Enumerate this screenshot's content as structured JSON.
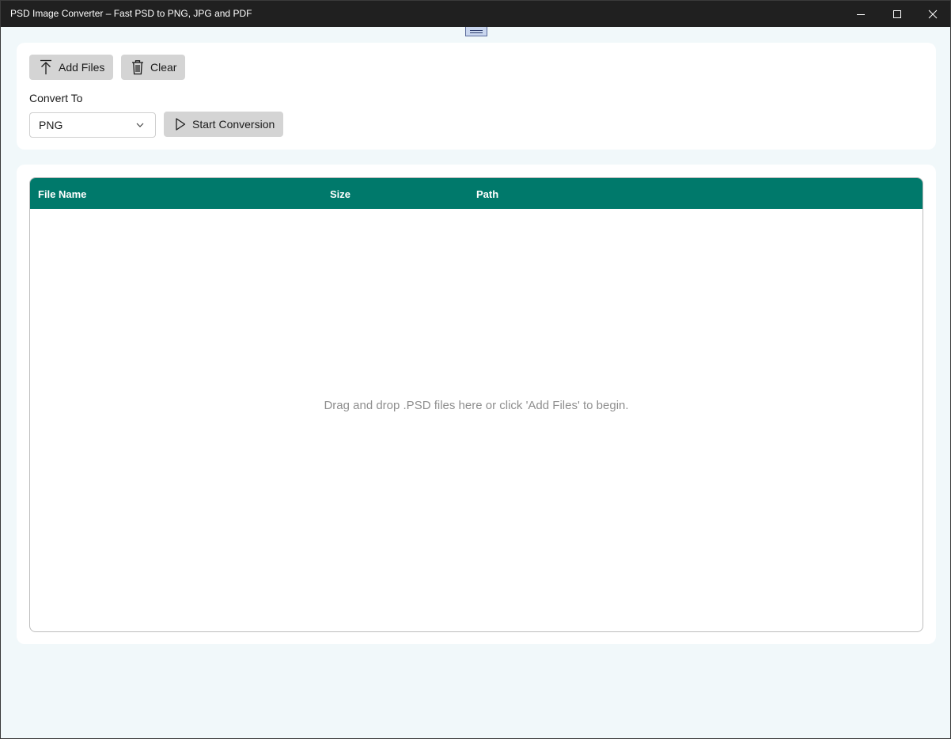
{
  "window": {
    "title": "PSD Image Converter – Fast PSD to PNG, JPG and PDF",
    "minimize_icon": "minimize-icon",
    "maximize_icon": "maximize-icon",
    "close_icon": "close-icon"
  },
  "toolbar": {
    "add_files_label": "Add Files",
    "add_files_icon": "upload-arrow-icon",
    "clear_label": "Clear",
    "clear_icon": "trash-icon",
    "convert_to_label": "Convert To",
    "format_selected": "PNG",
    "start_label": "Start Conversion",
    "start_icon": "play-icon"
  },
  "grid": {
    "columns": [
      "File Name",
      "Size",
      "Path"
    ],
    "rows": [],
    "empty_message": "Drag and drop .PSD files here or click 'Add Files' to begin."
  },
  "colors": {
    "header_bg": "#00796b",
    "window_bg": "#f1f8fa",
    "button_bg": "#d4d4d4"
  }
}
